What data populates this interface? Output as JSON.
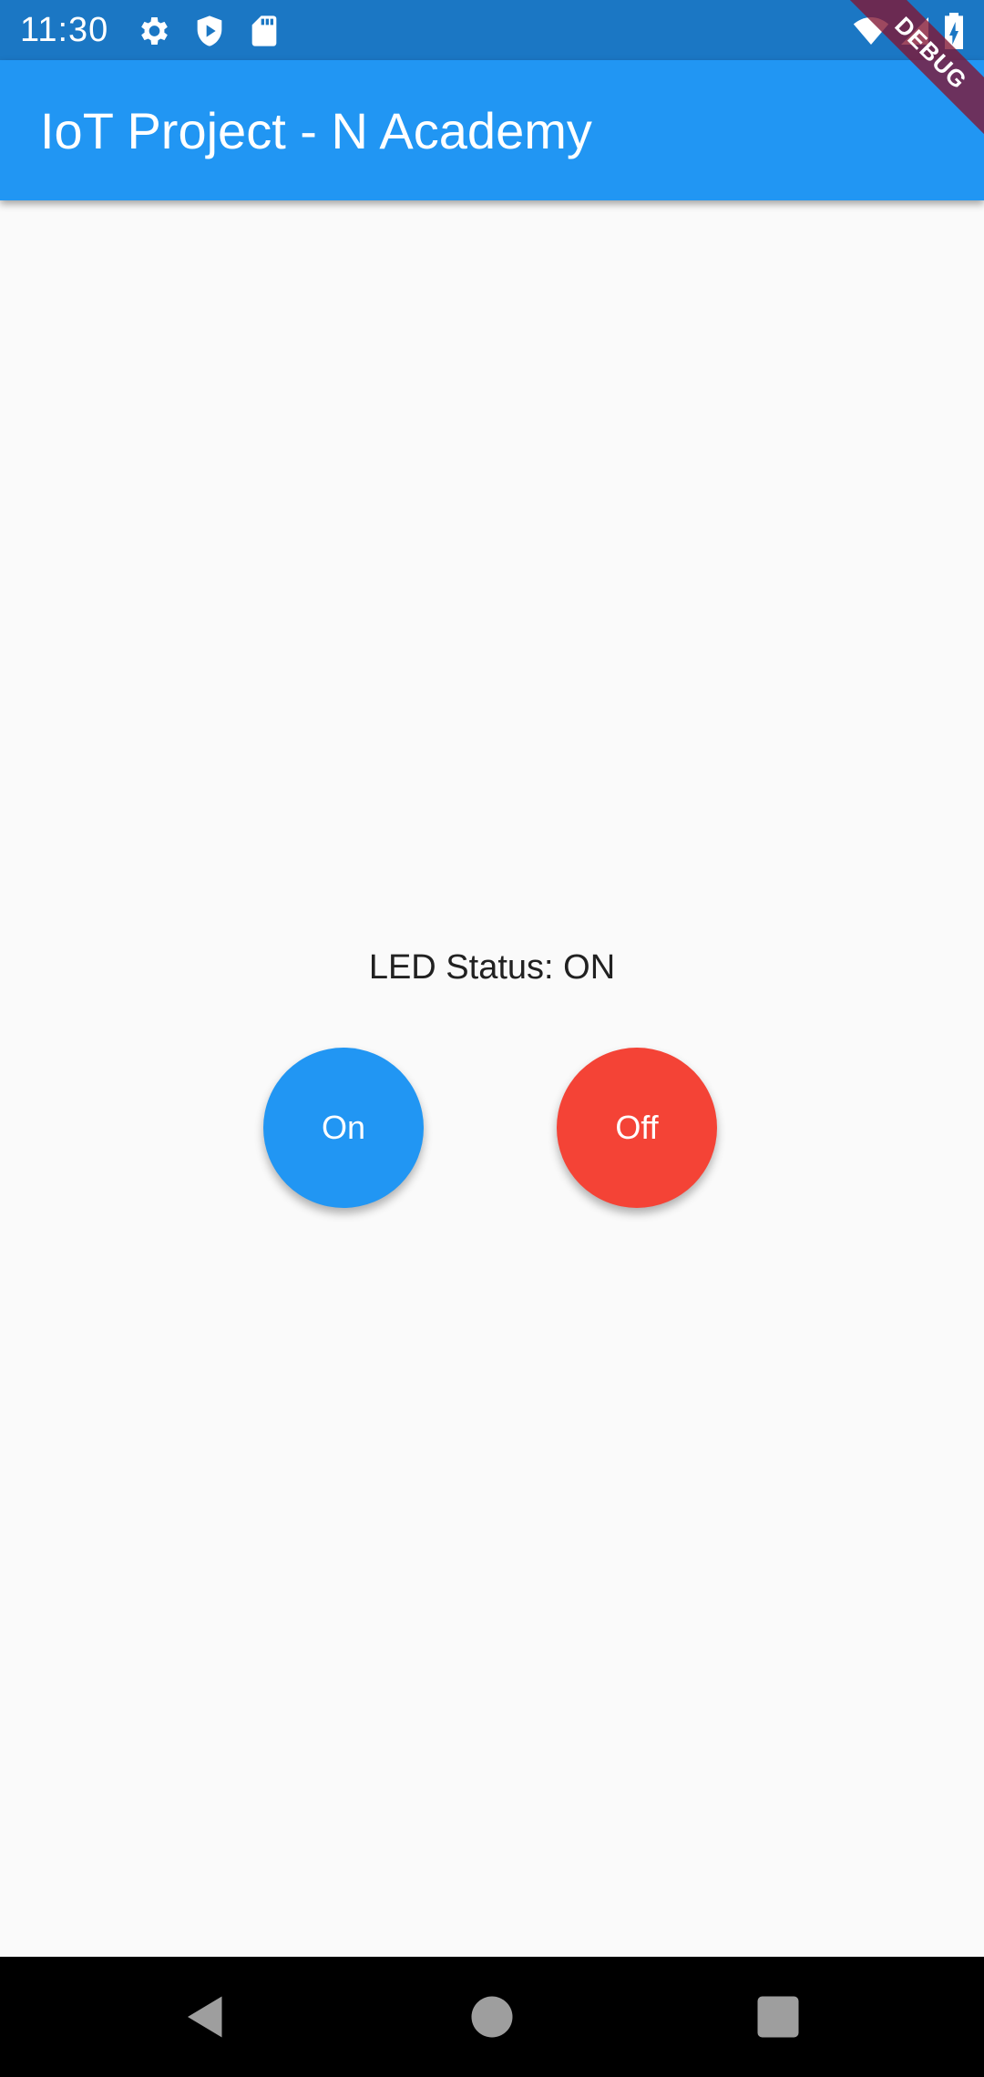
{
  "status_bar": {
    "time": "11:30",
    "left_icons": [
      "gear-icon",
      "shield-play-icon",
      "sd-card-icon"
    ],
    "right_icons": [
      "wifi-icon",
      "cell-signal-icon",
      "battery-charging-icon"
    ]
  },
  "debug_banner": {
    "label": "DEBUG"
  },
  "app_bar": {
    "title": "IoT Project - N Academy",
    "color": "#2196f3"
  },
  "main": {
    "led_status": "LED Status: ON",
    "buttons": {
      "on_label": "On",
      "on_color": "#2196f3",
      "off_label": "Off",
      "off_color": "#f44336"
    }
  },
  "nav_bar": {
    "buttons": [
      "back-icon",
      "home-icon",
      "recents-icon"
    ]
  }
}
